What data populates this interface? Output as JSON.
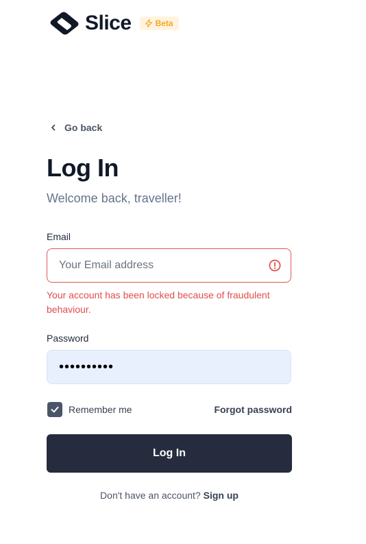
{
  "brand": {
    "name": "Slice",
    "badge": "Beta",
    "badge_icon": "lightning-icon",
    "accent_color": "#f6a623"
  },
  "nav": {
    "back_label": "Go back",
    "back_icon": "chevron-left-icon"
  },
  "heading": {
    "title": "Log In",
    "subtitle": "Welcome back, traveller!"
  },
  "form": {
    "email": {
      "label": "Email",
      "placeholder": "Your Email address",
      "value": "",
      "status_icon": "alert-circle-icon"
    },
    "error_message": "Your account has been locked because of fraudulent behaviour.",
    "password": {
      "label": "Password",
      "value": "••••••••••"
    },
    "remember": {
      "label": "Remember me",
      "checked": true
    },
    "forgot_label": "Forgot password",
    "submit_label": "Log In"
  },
  "footer": {
    "prompt": "Don't have an account?",
    "signup_label": "Sign up"
  },
  "colors": {
    "error": "#e24c4b",
    "primary_button": "#262c3e",
    "password_bg": "#e8f0fe"
  }
}
